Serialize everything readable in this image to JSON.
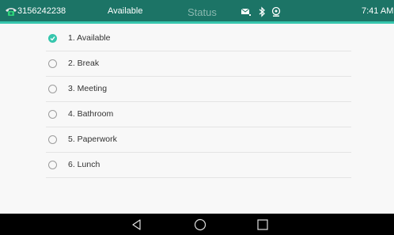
{
  "status_bar": {
    "phone_number": "3156242238",
    "status_label": "Available",
    "title": "Status",
    "time": "7:41 AM",
    "icons": [
      "phone-icon",
      "mail-icon",
      "bluetooth-icon",
      "voicemail-icon"
    ],
    "colors": {
      "bar": "#1c7466",
      "accent": "#36c6ad"
    }
  },
  "status_options": [
    {
      "label": "1. Available",
      "selected": true
    },
    {
      "label": "2. Break",
      "selected": false
    },
    {
      "label": "3. Meeting",
      "selected": false
    },
    {
      "label": "4. Bathroom",
      "selected": false
    },
    {
      "label": "5. Paperwork",
      "selected": false
    },
    {
      "label": "6. Lunch",
      "selected": false
    }
  ],
  "nav_bar": {
    "buttons": [
      "back-icon",
      "home-icon",
      "recents-icon"
    ]
  }
}
